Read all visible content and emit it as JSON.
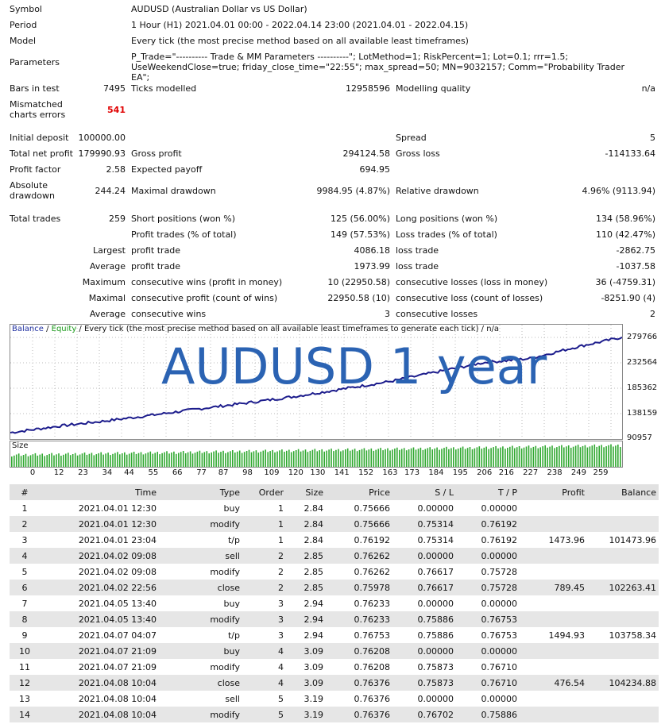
{
  "header": {
    "symbol_label": "Symbol",
    "symbol_value": "AUDUSD (Australian Dollar vs US Dollar)",
    "period_label": "Period",
    "period_value": "1 Hour (H1) 2021.04.01 00:00 - 2022.04.14 23:00 (2021.04.01 - 2022.04.15)",
    "model_label": "Model",
    "model_value": "Every tick (the most precise method based on all available least timeframes)",
    "parameters_label": "Parameters",
    "parameters_value": "P_Trade=\"---------- Trade & MM Parameters ----------\"; LotMethod=1; RiskPercent=1; Lot=0.1; rrr=1.5; UseWeekendClose=true; friday_close_time=\"22:55\"; max_spread=50; MN=9032157; Comm=\"Probability Trader EA\";"
  },
  "stats": {
    "bars_label": "Bars in test",
    "bars_value": "7495",
    "ticks_label": "Ticks modelled",
    "ticks_value": "12958596",
    "quality_label": "Modelling quality",
    "quality_value": "n/a",
    "mismatch_label": "Mismatched charts errors",
    "mismatch_value": "541",
    "initial_label": "Initial deposit",
    "initial_value": "100000.00",
    "spread_label": "Spread",
    "spread_value": "5",
    "net_label": "Total net profit",
    "net_value": "179990.93",
    "gross_profit_label": "Gross profit",
    "gross_profit_value": "294124.58",
    "gross_loss_label": "Gross loss",
    "gross_loss_value": "-114133.64",
    "pf_label": "Profit factor",
    "pf_value": "2.58",
    "payoff_label": "Expected payoff",
    "payoff_value": "694.95",
    "abs_dd_label": "Absolute drawdown",
    "abs_dd_value": "244.24",
    "max_dd_label": "Maximal drawdown",
    "max_dd_value": "9984.95 (4.87%)",
    "rel_dd_label": "Relative drawdown",
    "rel_dd_value": "4.96% (9113.94)",
    "total_trades_label": "Total trades",
    "total_trades_value": "259",
    "short_label": "Short positions (won %)",
    "short_value": "125 (56.00%)",
    "long_label": "Long positions (won %)",
    "long_value": "134 (58.96%)",
    "profit_trades_label": "Profit trades (% of total)",
    "profit_trades_value": "149 (57.53%)",
    "loss_trades_label": "Loss trades (% of total)",
    "loss_trades_value": "110 (42.47%)",
    "largest_label": "Largest",
    "largest_profit_label": "profit trade",
    "largest_profit_value": "4086.18",
    "largest_loss_label": "loss trade",
    "largest_loss_value": "-2862.75",
    "average_label": "Average",
    "average_profit_label": "profit trade",
    "average_profit_value": "1973.99",
    "average_loss_label": "loss trade",
    "average_loss_value": "-1037.58",
    "maximum_label": "Maximum",
    "max_wins_label": "consecutive wins (profit in money)",
    "max_wins_value": "10 (22950.58)",
    "max_losses_label": "consecutive losses (loss in money)",
    "max_losses_value": "36 (-4759.31)",
    "maximal_label": "Maximal",
    "maximal_profit_label": "consecutive profit (count of wins)",
    "maximal_profit_value": "22950.58 (10)",
    "maximal_loss_label": "consecutive loss (count of losses)",
    "maximal_loss_value": "-8251.90 (4)",
    "avg_label": "Average",
    "avg_wins_label": "consecutive wins",
    "avg_wins_value": "3",
    "avg_losses_label": "consecutive losses",
    "avg_losses_value": "2"
  },
  "chart": {
    "legend_balance": "Balance",
    "legend_sep1": " / ",
    "legend_equity": "Equity",
    "legend_rest": " / Every tick (the most precise method based on all available least timeframes to generate each tick) / n/a",
    "overlay_title": "AUDUSD 1 year",
    "size_label": "Size",
    "colors": {
      "balance": "#1c1c8c",
      "size_bars": "#2fa82f",
      "overlay": "#2b63b3"
    }
  },
  "chart_data": {
    "type": "line",
    "series": [
      {
        "name": "Balance",
        "x": [
          0,
          20,
          40,
          60,
          80,
          100,
          120,
          140,
          160,
          180,
          200,
          220,
          240,
          259
        ],
        "values": [
          100000,
          112000,
          122000,
          133000,
          145000,
          156000,
          168000,
          182000,
          196000,
          214000,
          232000,
          240000,
          262000,
          279990
        ]
      }
    ],
    "y_ticks": [
      "279766",
      "232564",
      "185362",
      "138159",
      "90957"
    ],
    "x_ticks": [
      "0",
      "12",
      "23",
      "34",
      "44",
      "55",
      "66",
      "77",
      "87",
      "98",
      "109",
      "120",
      "130",
      "141",
      "152",
      "163",
      "173",
      "184",
      "195",
      "206",
      "216",
      "227",
      "238",
      "249",
      "259"
    ],
    "ylim": [
      90957,
      279766
    ],
    "xlim": [
      0,
      259
    ]
  },
  "table": {
    "headers": [
      "#",
      "Time",
      "Type",
      "Order",
      "Size",
      "Price",
      "S / L",
      "T / P",
      "Profit",
      "Balance"
    ],
    "rows": [
      [
        "1",
        "2021.04.01 12:30",
        "buy",
        "1",
        "2.84",
        "0.75666",
        "0.00000",
        "0.00000",
        "",
        ""
      ],
      [
        "2",
        "2021.04.01 12:30",
        "modify",
        "1",
        "2.84",
        "0.75666",
        "0.75314",
        "0.76192",
        "",
        ""
      ],
      [
        "3",
        "2021.04.01 23:04",
        "t/p",
        "1",
        "2.84",
        "0.76192",
        "0.75314",
        "0.76192",
        "1473.96",
        "101473.96"
      ],
      [
        "4",
        "2021.04.02 09:08",
        "sell",
        "2",
        "2.85",
        "0.76262",
        "0.00000",
        "0.00000",
        "",
        ""
      ],
      [
        "5",
        "2021.04.02 09:08",
        "modify",
        "2",
        "2.85",
        "0.76262",
        "0.76617",
        "0.75728",
        "",
        ""
      ],
      [
        "6",
        "2021.04.02 22:56",
        "close",
        "2",
        "2.85",
        "0.75978",
        "0.76617",
        "0.75728",
        "789.45",
        "102263.41"
      ],
      [
        "7",
        "2021.04.05 13:40",
        "buy",
        "3",
        "2.94",
        "0.76233",
        "0.00000",
        "0.00000",
        "",
        ""
      ],
      [
        "8",
        "2021.04.05 13:40",
        "modify",
        "3",
        "2.94",
        "0.76233",
        "0.75886",
        "0.76753",
        "",
        ""
      ],
      [
        "9",
        "2021.04.07 04:07",
        "t/p",
        "3",
        "2.94",
        "0.76753",
        "0.75886",
        "0.76753",
        "1494.93",
        "103758.34"
      ],
      [
        "10",
        "2021.04.07 21:09",
        "buy",
        "4",
        "3.09",
        "0.76208",
        "0.00000",
        "0.00000",
        "",
        ""
      ],
      [
        "11",
        "2021.04.07 21:09",
        "modify",
        "4",
        "3.09",
        "0.76208",
        "0.75873",
        "0.76710",
        "",
        ""
      ],
      [
        "12",
        "2021.04.08 10:04",
        "close",
        "4",
        "3.09",
        "0.76376",
        "0.75873",
        "0.76710",
        "476.54",
        "104234.88"
      ],
      [
        "13",
        "2021.04.08 10:04",
        "sell",
        "5",
        "3.19",
        "0.76376",
        "0.00000",
        "0.00000",
        "",
        ""
      ],
      [
        "14",
        "2021.04.08 10:04",
        "modify",
        "5",
        "3.19",
        "0.76376",
        "0.76702",
        "0.75886",
        "",
        ""
      ]
    ]
  }
}
